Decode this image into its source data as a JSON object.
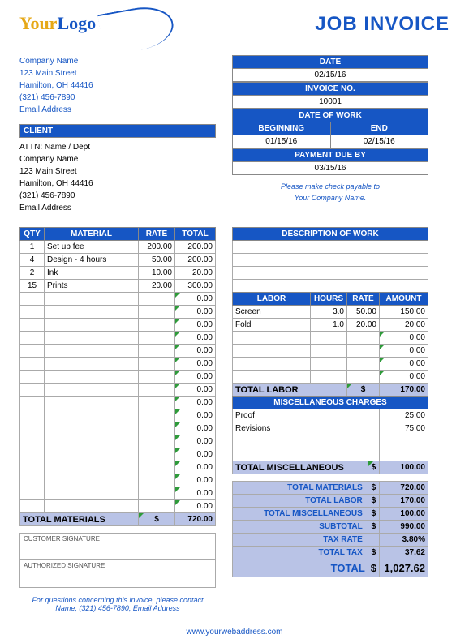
{
  "logo": {
    "your": "Your",
    "logo": "Logo"
  },
  "title": "JOB INVOICE",
  "company": {
    "name": "Company Name",
    "street": "123 Main Street",
    "city": "Hamilton, OH  44416",
    "phone": "(321) 456-7890",
    "email": "Email Address"
  },
  "meta": {
    "date_hdr": "DATE",
    "date": "02/15/16",
    "invno_hdr": "INVOICE NO.",
    "invno": "10001",
    "dow_hdr": "DATE OF WORK",
    "beg_hdr": "BEGINNING",
    "end_hdr": "END",
    "beg": "01/15/16",
    "end": "02/15/16",
    "due_hdr": "PAYMENT DUE BY",
    "due": "03/15/16"
  },
  "client_hdr": "CLIENT",
  "client": {
    "attn": "ATTN: Name / Dept",
    "name": "Company Name",
    "street": "123 Main Street",
    "city": "Hamilton, OH  44416",
    "phone": "(321) 456-7890",
    "email": "Email Address"
  },
  "payable": {
    "l1": "Please make check payable to",
    "l2": "Your Company Name."
  },
  "materials": {
    "hdr": {
      "qty": "QTY",
      "mat": "MATERIAL",
      "rate": "RATE",
      "total": "TOTAL"
    },
    "rows": [
      {
        "qty": "1",
        "mat": "Set up fee",
        "rate": "200.00",
        "total": "200.00"
      },
      {
        "qty": "4",
        "mat": "Design - 4 hours",
        "rate": "50.00",
        "total": "200.00"
      },
      {
        "qty": "2",
        "mat": "Ink",
        "rate": "10.00",
        "total": "20.00"
      },
      {
        "qty": "15",
        "mat": "Prints",
        "rate": "20.00",
        "total": "300.00"
      },
      {
        "qty": "",
        "mat": "",
        "rate": "",
        "total": "0.00"
      },
      {
        "qty": "",
        "mat": "",
        "rate": "",
        "total": "0.00"
      },
      {
        "qty": "",
        "mat": "",
        "rate": "",
        "total": "0.00"
      },
      {
        "qty": "",
        "mat": "",
        "rate": "",
        "total": "0.00"
      },
      {
        "qty": "",
        "mat": "",
        "rate": "",
        "total": "0.00"
      },
      {
        "qty": "",
        "mat": "",
        "rate": "",
        "total": "0.00"
      },
      {
        "qty": "",
        "mat": "",
        "rate": "",
        "total": "0.00"
      },
      {
        "qty": "",
        "mat": "",
        "rate": "",
        "total": "0.00"
      },
      {
        "qty": "",
        "mat": "",
        "rate": "",
        "total": "0.00"
      },
      {
        "qty": "",
        "mat": "",
        "rate": "",
        "total": "0.00"
      },
      {
        "qty": "",
        "mat": "",
        "rate": "",
        "total": "0.00"
      },
      {
        "qty": "",
        "mat": "",
        "rate": "",
        "total": "0.00"
      },
      {
        "qty": "",
        "mat": "",
        "rate": "",
        "total": "0.00"
      },
      {
        "qty": "",
        "mat": "",
        "rate": "",
        "total": "0.00"
      },
      {
        "qty": "",
        "mat": "",
        "rate": "",
        "total": "0.00"
      },
      {
        "qty": "",
        "mat": "",
        "rate": "",
        "total": "0.00"
      },
      {
        "qty": "",
        "mat": "",
        "rate": "",
        "total": "0.00"
      }
    ],
    "total_lbl": "TOTAL MATERIALS",
    "cur": "$",
    "total": "720.00"
  },
  "desc_hdr": "DESCRIPTION OF WORK",
  "desc_rows": [
    "",
    "",
    "",
    ""
  ],
  "labor": {
    "hdr": {
      "labor": "LABOR",
      "hours": "HOURS",
      "rate": "RATE",
      "amount": "AMOUNT"
    },
    "rows": [
      {
        "labor": "Screen",
        "hours": "3.0",
        "rate": "50.00",
        "amount": "150.00"
      },
      {
        "labor": "Fold",
        "hours": "1.0",
        "rate": "20.00",
        "amount": "20.00"
      },
      {
        "labor": "",
        "hours": "",
        "rate": "",
        "amount": "0.00"
      },
      {
        "labor": "",
        "hours": "",
        "rate": "",
        "amount": "0.00"
      },
      {
        "labor": "",
        "hours": "",
        "rate": "",
        "amount": "0.00"
      },
      {
        "labor": "",
        "hours": "",
        "rate": "",
        "amount": "0.00"
      }
    ],
    "total_lbl": "TOTAL LABOR",
    "cur": "$",
    "total": "170.00"
  },
  "misc": {
    "hdr": "MISCELLANEOUS CHARGES",
    "rows": [
      {
        "item": "Proof",
        "amount": "25.00"
      },
      {
        "item": "Revisions",
        "amount": "75.00"
      },
      {
        "item": "",
        "amount": ""
      },
      {
        "item": "",
        "amount": ""
      }
    ],
    "total_lbl": "TOTAL MISCELLANEOUS",
    "cur": "$",
    "total": "100.00"
  },
  "sig": {
    "customer": "CUSTOMER SIGNATURE",
    "authorized": "AUTHORIZED SIGNATURE"
  },
  "summary": {
    "mat_lbl": "TOTAL MATERIALS",
    "mat": "720.00",
    "lab_lbl": "TOTAL LABOR",
    "lab": "170.00",
    "misc_lbl": "TOTAL MISCELLANEOUS",
    "misc": "100.00",
    "sub_lbl": "SUBTOTAL",
    "sub": "990.00",
    "taxr_lbl": "TAX RATE",
    "taxr": "3.80%",
    "tax_lbl": "TOTAL TAX",
    "tax": "37.62",
    "total_lbl": "TOTAL",
    "total": "1,027.62",
    "cur": "$"
  },
  "footer": {
    "l1": "For questions concerning this invoice, please contact",
    "l2": "Name, (321) 456-7890, Email Address",
    "url": "www.yourwebaddress.com"
  }
}
